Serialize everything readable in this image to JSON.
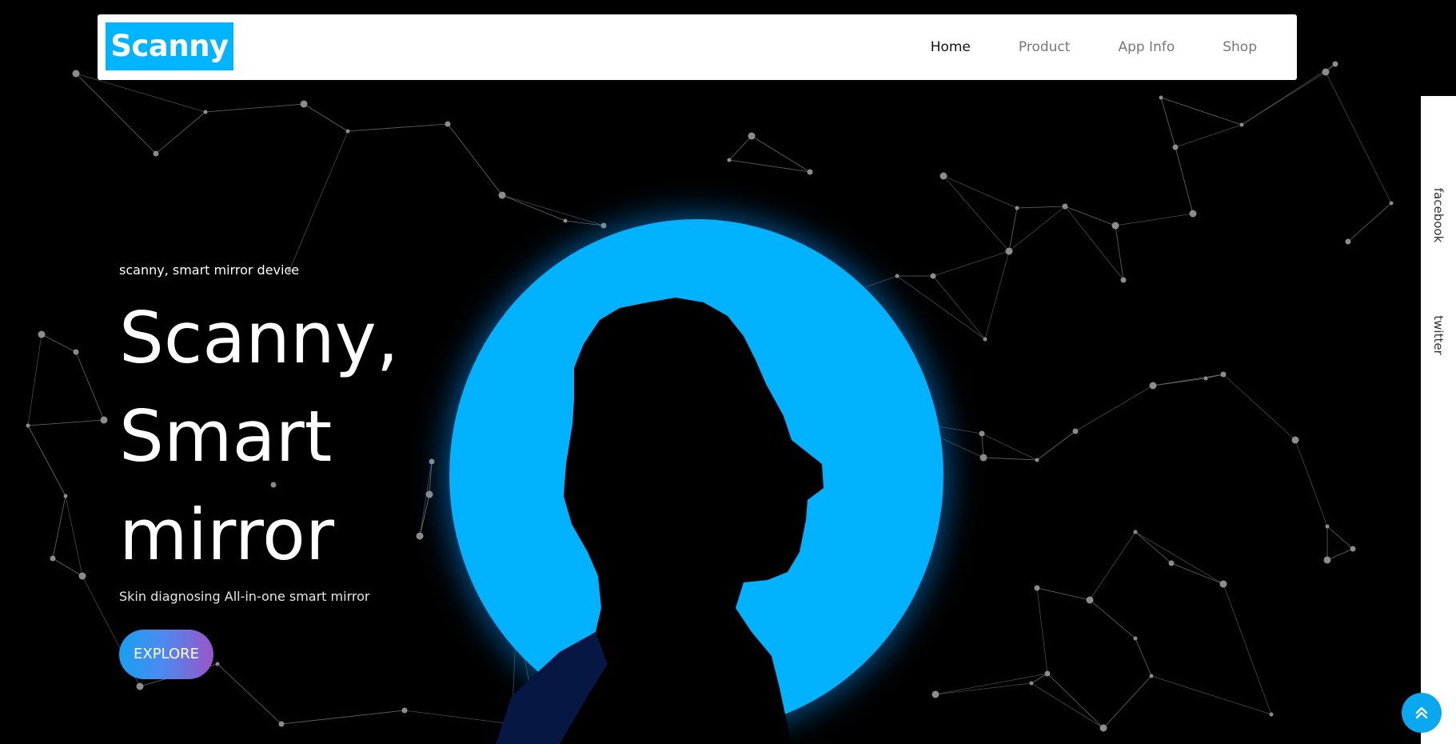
{
  "brand": {
    "name": "Scanny",
    "color": "#00b4ff"
  },
  "nav": {
    "items": [
      {
        "label": "Home",
        "active": true
      },
      {
        "label": "Product",
        "active": false
      },
      {
        "label": "App Info",
        "active": false
      },
      {
        "label": "Shop",
        "active": false
      }
    ]
  },
  "hero": {
    "eyebrow": "scanny, smart mirror device",
    "headline_lines": [
      "Scanny,",
      "Smart",
      "mirror"
    ],
    "subline": "Skin diagnosing All-in-one smart mirror",
    "cta_label": "EXPLORE",
    "circle_color": "#00b2ff"
  },
  "social": {
    "items": [
      {
        "label": "facebook"
      },
      {
        "label": "twitter"
      }
    ]
  },
  "icons": {
    "scroll_top": "double-chevron-up-icon"
  }
}
